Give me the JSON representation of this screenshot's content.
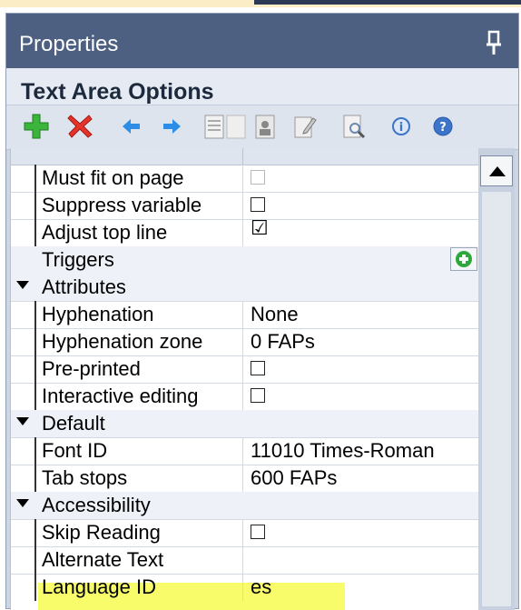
{
  "panel": {
    "title": "Properties"
  },
  "section": {
    "title": "Text Area Options"
  },
  "toolbar": {
    "buttons": [
      "add-icon",
      "delete-icon",
      "arrow-left-icon",
      "arrow-right-icon",
      "document-icon",
      "blank-page-icon",
      "image-icon",
      "edit-pencil-icon",
      "preview-magnifier-icon",
      "info-icon",
      "help-icon"
    ]
  },
  "rows": {
    "must_fit": {
      "name": "Must fit on page",
      "checked": false,
      "disabled": true
    },
    "suppress": {
      "name": "Suppress variable",
      "checked": false
    },
    "adjust": {
      "name": "Adjust top line",
      "checked": true,
      "value_glyph": "☑"
    },
    "triggers": {
      "name": "Triggers"
    },
    "attributes": {
      "name": "Attributes"
    },
    "hyphenation": {
      "name": "Hyphenation",
      "value": "None"
    },
    "hyphenation_zone": {
      "name": "Hyphenation zone",
      "value": "0 FAPs"
    },
    "preprinted": {
      "name": "Pre-printed",
      "checked": false
    },
    "interactive": {
      "name": "Interactive editing",
      "checked": false
    },
    "default": {
      "name": "Default"
    },
    "font_id": {
      "name": "Font ID",
      "value": "11010 Times-Roman"
    },
    "tab_stops": {
      "name": "Tab stops",
      "value": "600 FAPs"
    },
    "accessibility": {
      "name": "Accessibility"
    },
    "skip_reading": {
      "name": "Skip Reading",
      "checked": false
    },
    "alt_text": {
      "name": "Alternate Text",
      "value": ""
    },
    "language_id": {
      "name": "Language ID",
      "value": "es"
    }
  },
  "colors": {
    "title_bar": "#4d6082",
    "panel_bg": "#ced6e4",
    "highlight": "#f8fb6a"
  }
}
